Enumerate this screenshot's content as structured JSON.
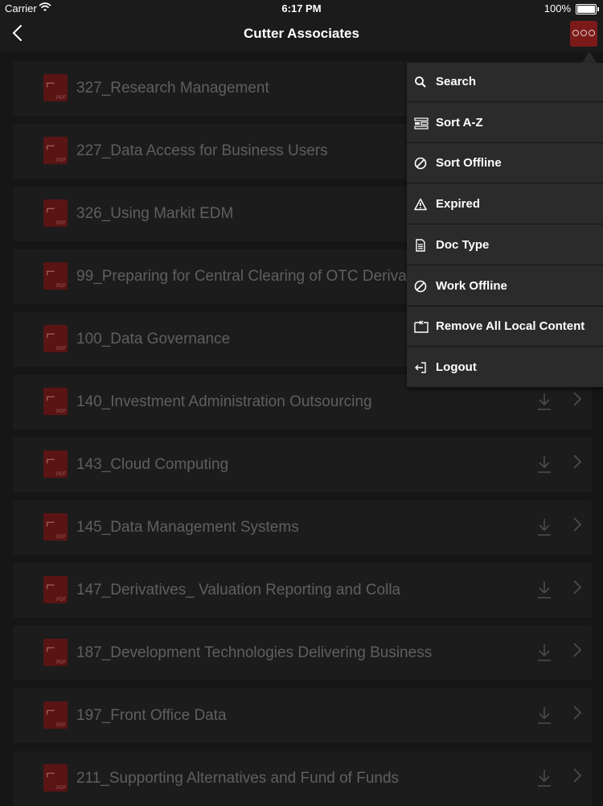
{
  "status": {
    "carrier": "Carrier",
    "time": "6:17 PM",
    "battery": "100%",
    "battery_level": 1.0
  },
  "nav": {
    "title": "Cutter Associates"
  },
  "documents": [
    {
      "title": "327_Research Management"
    },
    {
      "title": "227_Data Access for Business Users"
    },
    {
      "title": "326_Using Markit EDM"
    },
    {
      "title": "99_Preparing for Central Clearing of OTC Deriva"
    },
    {
      "title": "100_Data Governance"
    },
    {
      "title": "140_Investment Administration Outsourcing"
    },
    {
      "title": "143_Cloud Computing"
    },
    {
      "title": "145_Data Management Systems"
    },
    {
      "title": "147_Derivatives_ Valuation Reporting and Colla"
    },
    {
      "title": "187_Development Technologies Delivering Business"
    },
    {
      "title": "197_Front Office Data"
    },
    {
      "title": "211_Supporting Alternatives and Fund of Funds"
    }
  ],
  "pdf_badge": "PDF",
  "menu": {
    "items": [
      {
        "label": "Search",
        "icon": "search-icon"
      },
      {
        "label": "Sort A-Z",
        "icon": "sort-icon"
      },
      {
        "label": "Sort Offline",
        "icon": "no-entry-icon"
      },
      {
        "label": "Expired",
        "icon": "warning-icon"
      },
      {
        "label": "Doc Type",
        "icon": "document-icon"
      },
      {
        "label": "Work Offline",
        "icon": "no-entry-icon"
      },
      {
        "label": "Remove All Local Content",
        "icon": "remove-content-icon"
      },
      {
        "label": "Logout",
        "icon": "logout-icon"
      }
    ]
  },
  "colors": {
    "accent": "#7c1a1a",
    "background": "#161616",
    "menu": "#2b2b2b"
  }
}
